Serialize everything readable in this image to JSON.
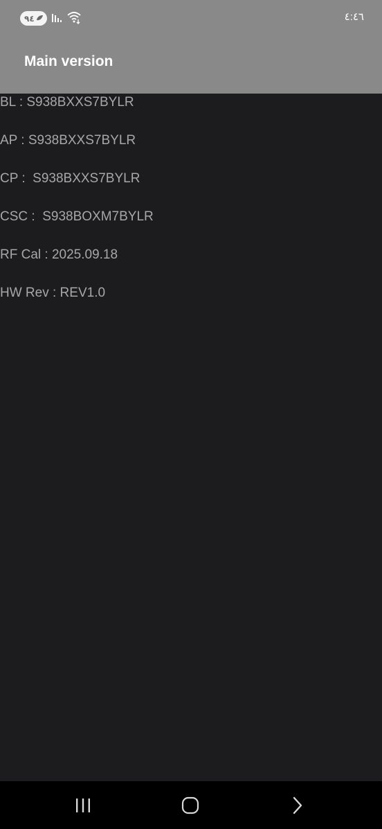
{
  "status_bar": {
    "battery_level": "٩٤",
    "time": "٤:٤٦"
  },
  "header": {
    "title": "Main version"
  },
  "info": [
    {
      "text": "BL : S938BXXS7BYLR"
    },
    {
      "text": "AP : S938BXXS7BYLR"
    },
    {
      "text": "CP :  S938BXXS7BYLR"
    },
    {
      "text": "CSC :  S938BOXM7BYLR"
    },
    {
      "text": "RF Cal : 2025.09.18"
    },
    {
      "text": "HW Rev : REV1.0"
    }
  ],
  "nav_bar": {
    "icons": [
      "recent-apps-icon",
      "home-icon",
      "back-icon"
    ]
  },
  "colors": {
    "header_bg": "#898989",
    "body_bg": "#1c1c1e",
    "text": "#a7a7a9",
    "nav_bg": "#000000"
  }
}
